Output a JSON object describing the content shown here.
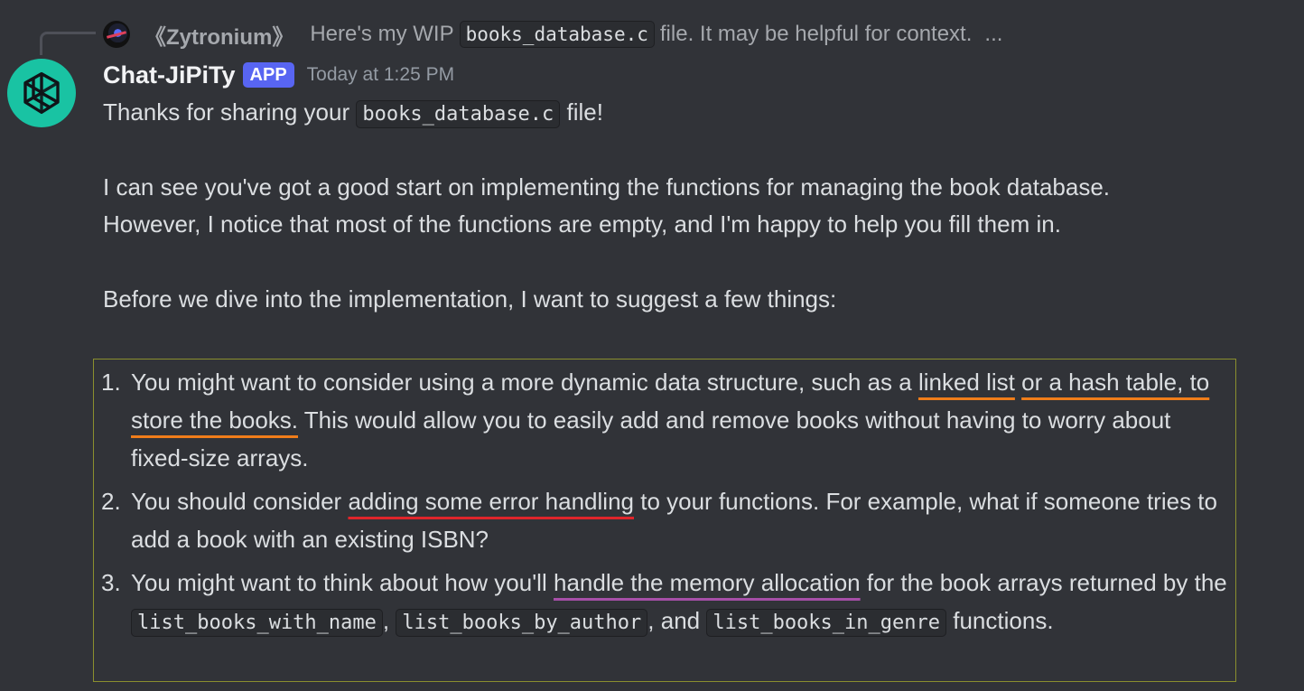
{
  "reply": {
    "author": "《Zytronium》",
    "text_before": "Here's my WIP",
    "code": "books_database.c",
    "text_after": "file. It may be helpful for context.",
    "ellipsis": "..."
  },
  "message": {
    "author": "Chat-JiPiTy",
    "badge": "APP",
    "timestamp": "Today at 1:25 PM",
    "line1_before": "Thanks for sharing your",
    "line1_code": "books_database.c",
    "line1_after": "file!",
    "para2_line1": "I can see you've got a good start on implementing the functions for managing the book database.",
    "para2_line2": "However, I notice that most of the functions are empty, and I'm happy to help you fill them in.",
    "para3": "Before we dive into the implementation, I want to suggest a few things:",
    "items": [
      {
        "num": "1.",
        "a": "You might want to consider using a more dynamic data structure, such as a",
        "hl1": "linked list",
        "hl2": "or a hash table, to store the books.",
        "b": "This would allow you to easily add and remove books without having to worry about fixed-size arrays."
      },
      {
        "num": "2.",
        "a": "You should consider",
        "hl": "adding some error handling",
        "b": "to your functions. For example, what if someone tries to add a book with an existing ISBN?"
      },
      {
        "num": "3.",
        "a": "You might want to think about how you'll",
        "hl": "handle the memory allocation",
        "b": "for the book arrays returned by the",
        "code1": "list_books_with_name",
        "sep1": ",",
        "code2": "list_books_by_author",
        "sep2": ", and",
        "code3": "list_books_in_genre",
        "c": "functions."
      }
    ]
  },
  "colors": {
    "background": "#313338",
    "avatar": "#19c3a3",
    "badge": "#5865f2",
    "highlight_orange": "#f07d1a",
    "highlight_red": "#e0252b",
    "highlight_purple": "#a64fa8",
    "box_border": "#8a8f2e"
  },
  "icons": {
    "avatar": "openai-logo-icon",
    "reply_avatar": "user-avatar"
  }
}
